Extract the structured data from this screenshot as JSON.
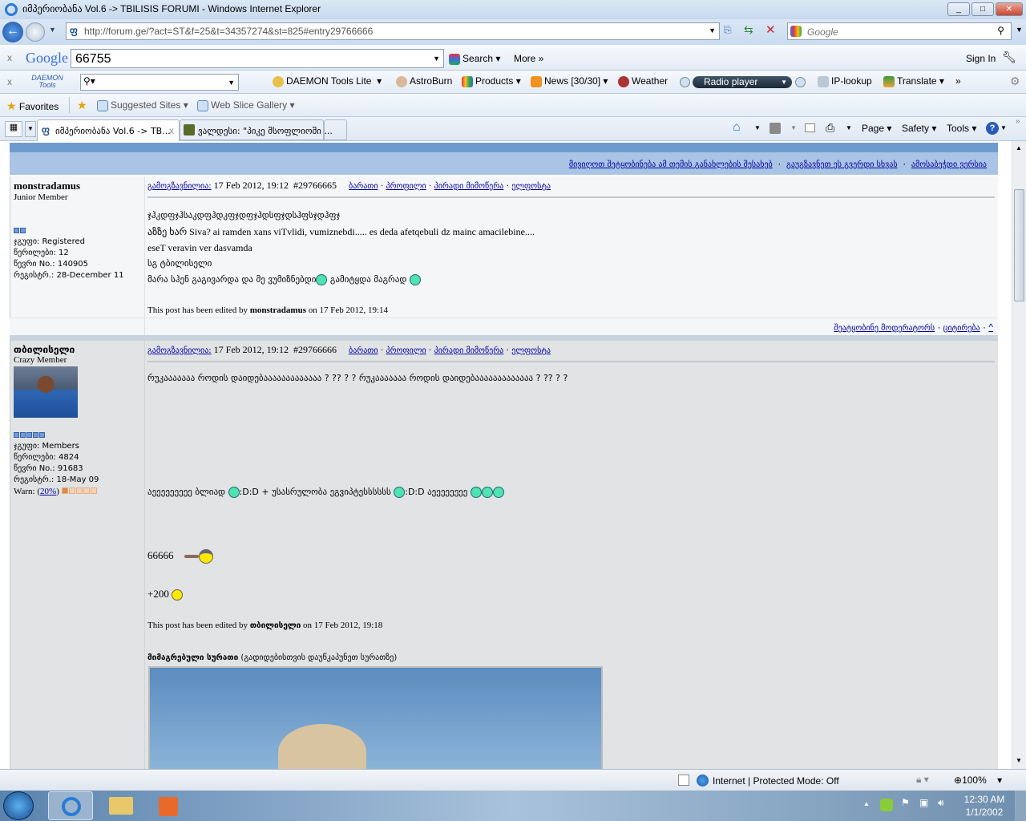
{
  "window": {
    "title": "იმპერიობანა Vol.6 -> TBILISIS FORUMI - Windows Internet Explorer",
    "minimize": "_",
    "maximize": "□",
    "close": "✕"
  },
  "address": {
    "url": "http://forum.ge/?act=ST&f=25&t=34357274&st=825#entry29766666",
    "search_placeholder": "Google"
  },
  "google_bar": {
    "logo": "Google",
    "query": "66755",
    "search": "Search",
    "more": "More »",
    "sign_in": "Sign In"
  },
  "daemon_bar": {
    "logo": "DAEMON Tools",
    "items": [
      "DAEMON Tools Lite",
      "AstroBurn",
      "Products",
      "News [30/30]",
      "Weather",
      "Radio player",
      "IP-lookup",
      "Translate",
      "»"
    ]
  },
  "favorites": {
    "label": "Favorites",
    "items": [
      "Suggested Sites",
      "Web Slice Gallery"
    ]
  },
  "tabs": [
    {
      "label": "იმპერიობანა Vol.6 -> TB..."
    },
    {
      "label": "ვალდესი: \"პიკე მსოფლიოში ..."
    }
  ],
  "command_bar": {
    "page": "Page",
    "safety": "Safety",
    "tools": "Tools"
  },
  "topic_links": [
    "მივიღოთ შეტყობინება ამ თემის განახლების შესახებ",
    "გაუგზავნეთ ეს გვერდი სხვას",
    "ამოსაბეჭდი ვერსია"
  ],
  "posts": [
    {
      "author": "monstradamus",
      "rank": "Junior Member",
      "group": "ჯგუფი: Registered",
      "posts": "წერილები: 12",
      "member_no": "წევრი No.: 140905",
      "registered": "რეგისტრ.: 28-December 11",
      "posted_label": "გამოგზავნილია:",
      "date": "17 Feb 2012, 19:12",
      "id": "#29766665",
      "actions": [
        "ბარათი",
        "პროფილი",
        "პირადი მიმოწერა",
        "ელფოსტა"
      ],
      "lines": [
        "ჯჰკდფჯჰსაკდფჰდკფჯდფჯჰდსფჯდსჰფსჯდჰფჯ",
        "აზზე ხარ Siva? ai ramden xans viTvlidi, vumiznebdi..... es deda afetqebuli dz mainc amacilebine....",
        "eseT veravin ver dasvamda",
        "სგ ტბილისელი",
        "მარა სჰენ გაგივარდა და მე ვუმიზნებდი",
        "გამიტყდა მაგრად"
      ],
      "edited_prefix": "This post has been edited by",
      "edited_by": "monstradamus",
      "edited_suffix": "on 17 Feb 2012, 19:14",
      "footer": [
        "შეატყობინე მოდერატორს",
        "ციტირება",
        "^"
      ]
    },
    {
      "author": "თბილისელი",
      "rank": "Crazy Member",
      "group": "ჯგუფი: Members",
      "posts": "წერილები: 4824",
      "member_no": "წევრი No.: 91683",
      "registered": "რეგისტრ.: 18-May 09",
      "warn_label": "Warn: (",
      "warn_value": "20%",
      "warn_close": ")",
      "posted_label": "გამოგზავნილია:",
      "date": "17 Feb 2012, 19:12",
      "id": "#29766666",
      "actions": [
        "ბარათი",
        "პროფილი",
        "პირადი მიმოწერა",
        "ელფოსტა"
      ],
      "line1": "რუკააააააა როდის დაიდებააააააააააააა ? ?? ? ? რუკააააააა როდის დაიდებააააააააააააა ? ?? ? ?",
      "line2a": "აეეეეეეეეე ბლიად",
      "line2b": ":D:D + უსასრულობა ეგვიპტესსსსსს",
      "line2c": ":D:D აეეეეეეეე",
      "line3": "66666",
      "line4": "+200",
      "edited_prefix": "This post has been edited by",
      "edited_by": "თბილისელი",
      "edited_suffix": "on 17 Feb 2012, 19:18",
      "attach_label": "მიმაგრებული სურათი",
      "attach_hint": "(გადიდებისთვის დაუწკაპუნეთ სურათზე)"
    }
  ],
  "status": {
    "zone": "Internet | Protected Mode: Off",
    "zoom": "100%"
  },
  "taskbar": {
    "time": "12:30 AM",
    "date": "1/1/2002"
  }
}
